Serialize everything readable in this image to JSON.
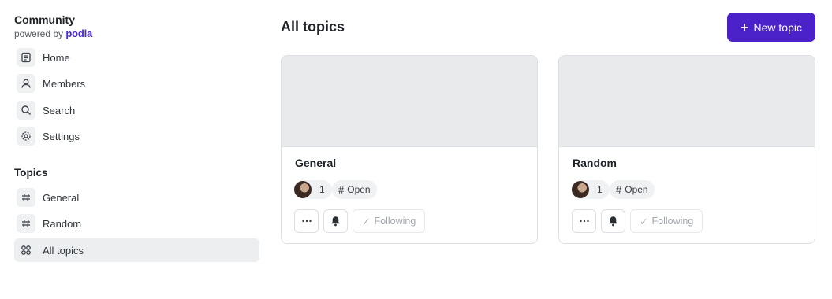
{
  "brand": {
    "title": "Community",
    "powered_by": "powered by",
    "logo_text": "podia",
    "accent": "#4b2ad1"
  },
  "sidebar": {
    "nav": [
      {
        "label": "Home",
        "icon": "document-icon"
      },
      {
        "label": "Members",
        "icon": "user-icon"
      },
      {
        "label": "Search",
        "icon": "search-icon"
      },
      {
        "label": "Settings",
        "icon": "gear-icon"
      }
    ],
    "section_title": "Topics",
    "topics": [
      {
        "label": "General",
        "icon": "hash-icon"
      },
      {
        "label": "Random",
        "icon": "hash-icon"
      },
      {
        "label": "All topics",
        "icon": "grid-icon",
        "active": true
      }
    ]
  },
  "main": {
    "title": "All topics",
    "new_topic_label": "New topic",
    "button_color": "#4b21c9",
    "cards": [
      {
        "title": "General",
        "member_count": "1",
        "status": "Open",
        "follow_label": "Following"
      },
      {
        "title": "Random",
        "member_count": "1",
        "status": "Open",
        "follow_label": "Following"
      }
    ]
  }
}
